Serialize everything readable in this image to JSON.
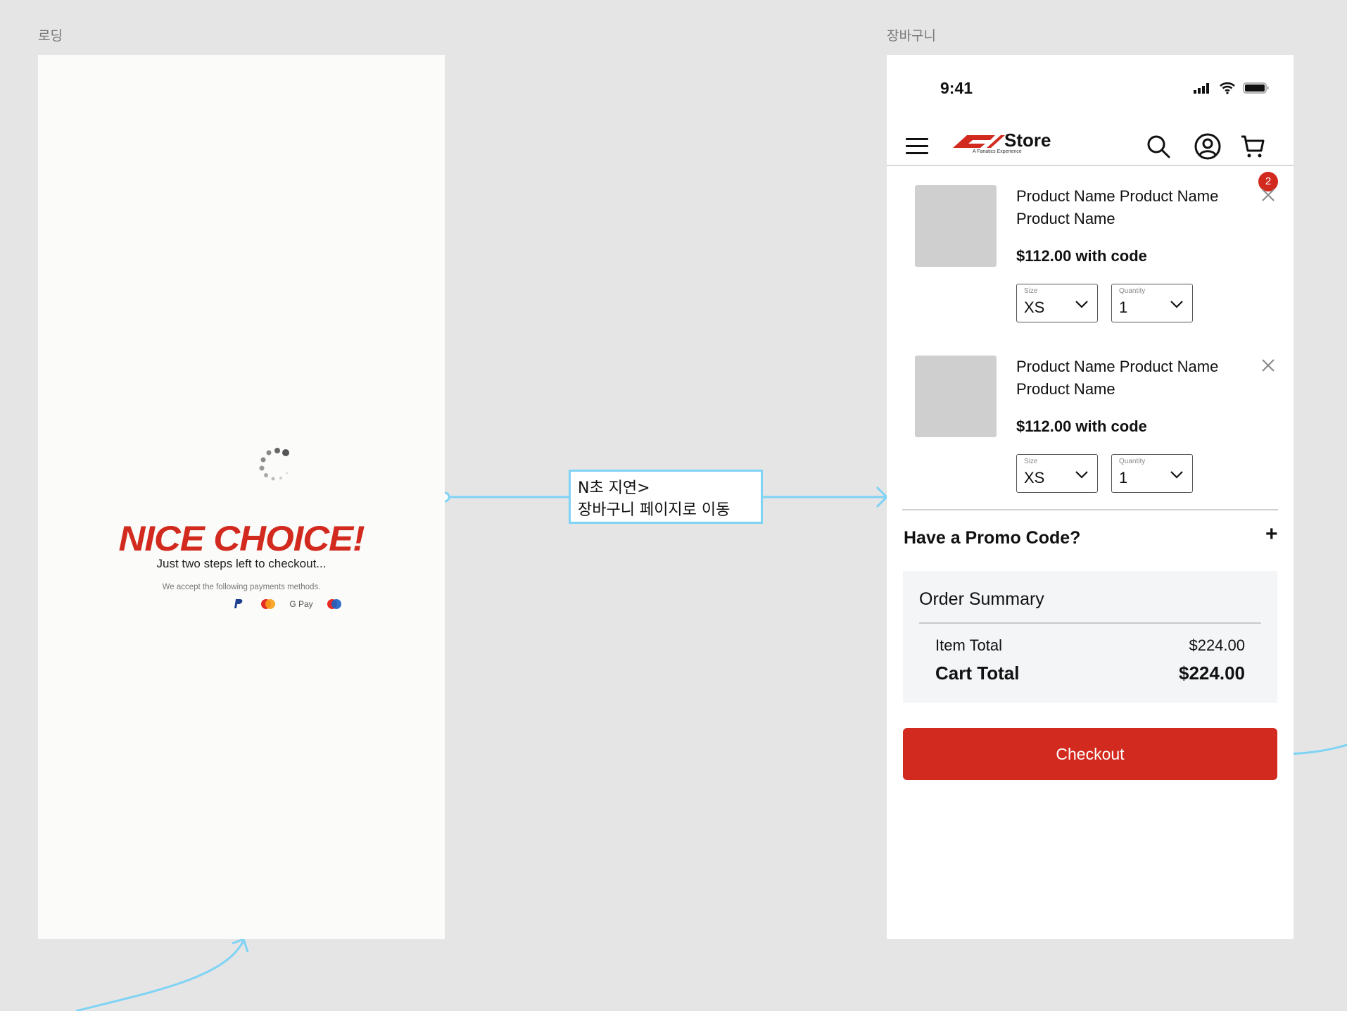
{
  "frames": {
    "loading": {
      "label": "로딩",
      "title": "NICE CHOICE!",
      "subtitle": "Just two steps left to checkout...",
      "payments_text": "We accept the following payments methods.",
      "payment_methods": [
        "paypal-icon",
        "mastercard-icon",
        "google-pay-icon",
        "maestro-icon"
      ],
      "gpay_text": "G Pay"
    },
    "cart": {
      "label": "장바구니"
    }
  },
  "transition_note": {
    "line1": "N초 지연>",
    "line2": "장바구니 페이지로 이동"
  },
  "status": {
    "time": "9:41"
  },
  "header": {
    "logo_text": "Store",
    "logo_tagline": "A Fanatics Experience",
    "cart_count": "2"
  },
  "items": [
    {
      "name": "Product Name Product Name Product Name",
      "price": "$112.00 with code",
      "size_label": "Size",
      "size": "XS",
      "qty_label": "Quantity",
      "qty": "1"
    },
    {
      "name": "Product Name Product Name Product Name",
      "price": "$112.00 with code",
      "size_label": "Size",
      "size": "XS",
      "qty_label": "Quantity",
      "qty": "1"
    }
  ],
  "promo": {
    "label": "Have a Promo Code?",
    "toggle": "+"
  },
  "summary": {
    "title": "Order Summary",
    "item_total_label": "Item Total",
    "item_total_value": "$224.00",
    "cart_total_label": "Cart Total",
    "cart_total_value": "$224.00"
  },
  "checkout_label": "Checkout",
  "colors": {
    "brand_red": "#d22a1e",
    "connector": "#7fd3f5",
    "canvas": "#e5e5e5"
  }
}
